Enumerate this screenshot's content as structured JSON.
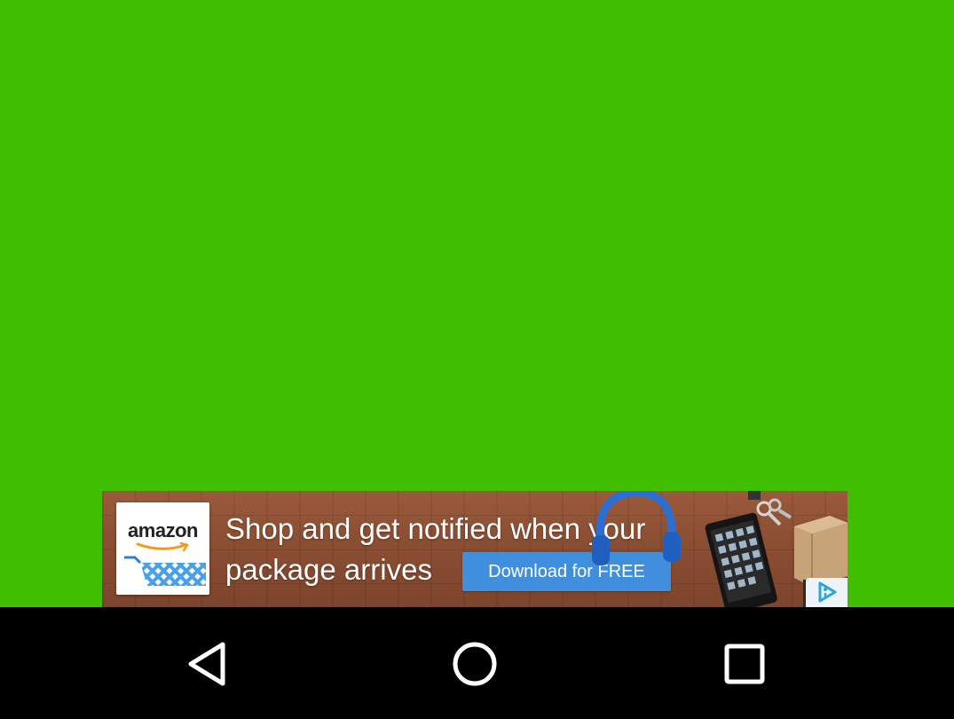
{
  "app": {
    "background_color": "#3fbf00"
  },
  "ad": {
    "brand_name": "amazon",
    "headline_line1": "Shop and get notified when your",
    "headline_line2": "package arrives",
    "cta_label": "Download for FREE",
    "cta_color": "#3f8fdd",
    "ad_choices_icon": "ad-choices-icon"
  },
  "nav_bar": {
    "back_icon": "back-icon",
    "home_icon": "home-icon",
    "recents_icon": "recents-icon"
  }
}
